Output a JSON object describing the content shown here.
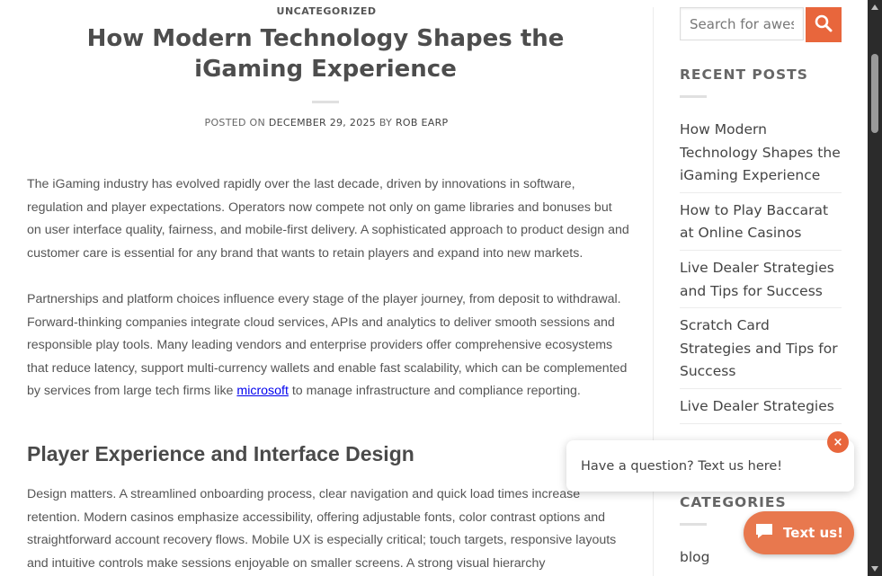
{
  "article": {
    "category": "UNCATEGORIZED",
    "title_line1": "How Modern Technology Shapes the",
    "title_line2": "iGaming Experience",
    "meta": {
      "posted_on": "POSTED ON",
      "date": "DECEMBER 29, 2025",
      "by": "BY",
      "author": "ROB EARP"
    },
    "p1": "The iGaming industry has evolved rapidly over the last decade, driven by innovations in software, regulation and player expectations. Operators now compete not only on game libraries and bonuses but on user interface quality, fairness, and mobile-first delivery. A sophisticated approach to product design and customer care is essential for any brand that wants to retain players and expand into new markets.",
    "p2_before": "Partnerships and platform choices influence every stage of the player journey, from deposit to withdrawal. Forward-thinking companies integrate cloud services, APIs and analytics to deliver smooth sessions and responsible play tools. Many leading vendors and enterprise providers offer comprehensive ecosystems that reduce latency, support multi-currency wallets and enable fast scalability, which can be complemented by services from large tech firms like ",
    "p2_link": "microsoft",
    "p2_after": " to manage infrastructure and compliance reporting.",
    "h2": "Player Experience and Interface Design",
    "p3": "Design matters. A streamlined onboarding process, clear navigation and quick load times increase retention. Modern casinos emphasize accessibility, offering adjustable fonts, color contrast options and straightforward account recovery flows. Mobile UX is especially critical; touch targets, responsive layouts and intuitive controls make sessions enjoyable on smaller screens. A strong visual hierarchy"
  },
  "sidebar": {
    "search_placeholder": "Search for awesome",
    "recent_title": "RECENT POSTS",
    "recent_posts": [
      "How Modern Technology Shapes the iGaming Experience",
      "How to Play Baccarat at Online Casinos",
      "Live Dealer Strategies and Tips for Success",
      "Scratch Card Strategies and Tips for Success",
      "Live Dealer Strategies"
    ],
    "categories_title": "CATEGORIES",
    "categories": [
      "blog"
    ]
  },
  "chat": {
    "prompt": "Have a question? Text us here!",
    "close": "×",
    "button": "Text us!"
  },
  "colors": {
    "accent": "#e8663c",
    "text_us": "#e8784e",
    "link": "#0000ee"
  }
}
